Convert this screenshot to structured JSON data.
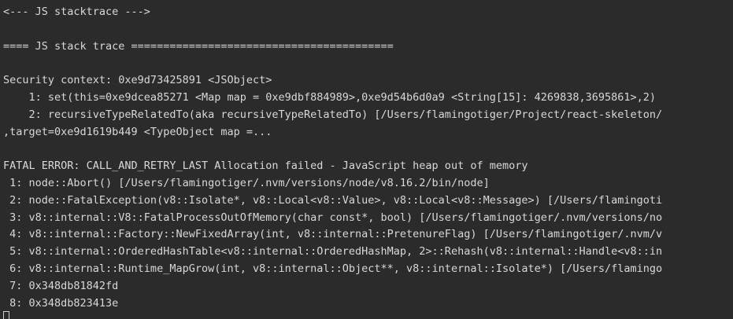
{
  "terminal": {
    "lines": [
      "<--- JS stacktrace --->",
      "",
      "==== JS stack trace =========================================",
      "",
      "Security context: 0xe9d73425891 <JSObject>",
      "    1: set(this=0xe9dcea85271 <Map map = 0xe9dbf884989>,0xe9d54b6d0a9 <String[15]: 4269838,3695861>,2)",
      "    2: recursiveTypeRelatedTo(aka recursiveTypeRelatedTo) [/Users/flamingotiger/Project/react-skeleton/",
      ",target=0xe9d1619b449 <TypeObject map =...",
      "",
      "FATAL ERROR: CALL_AND_RETRY_LAST Allocation failed - JavaScript heap out of memory",
      " 1: node::Abort() [/Users/flamingotiger/.nvm/versions/node/v8.16.2/bin/node]",
      " 2: node::FatalException(v8::Isolate*, v8::Local<v8::Value>, v8::Local<v8::Message>) [/Users/flamingoti",
      " 3: v8::internal::V8::FatalProcessOutOfMemory(char const*, bool) [/Users/flamingotiger/.nvm/versions/no",
      " 4: v8::internal::Factory::NewFixedArray(int, v8::internal::PretenureFlag) [/Users/flamingotiger/.nvm/v",
      " 5: v8::internal::OrderedHashTable<v8::internal::OrderedHashMap, 2>::Rehash(v8::internal::Handle<v8::in",
      " 6: v8::internal::Runtime_MapGrow(int, v8::internal::Object**, v8::internal::Isolate*) [/Users/flamingo",
      " 7: 0x348db81842fd",
      " 8: 0x348db823413e"
    ]
  }
}
